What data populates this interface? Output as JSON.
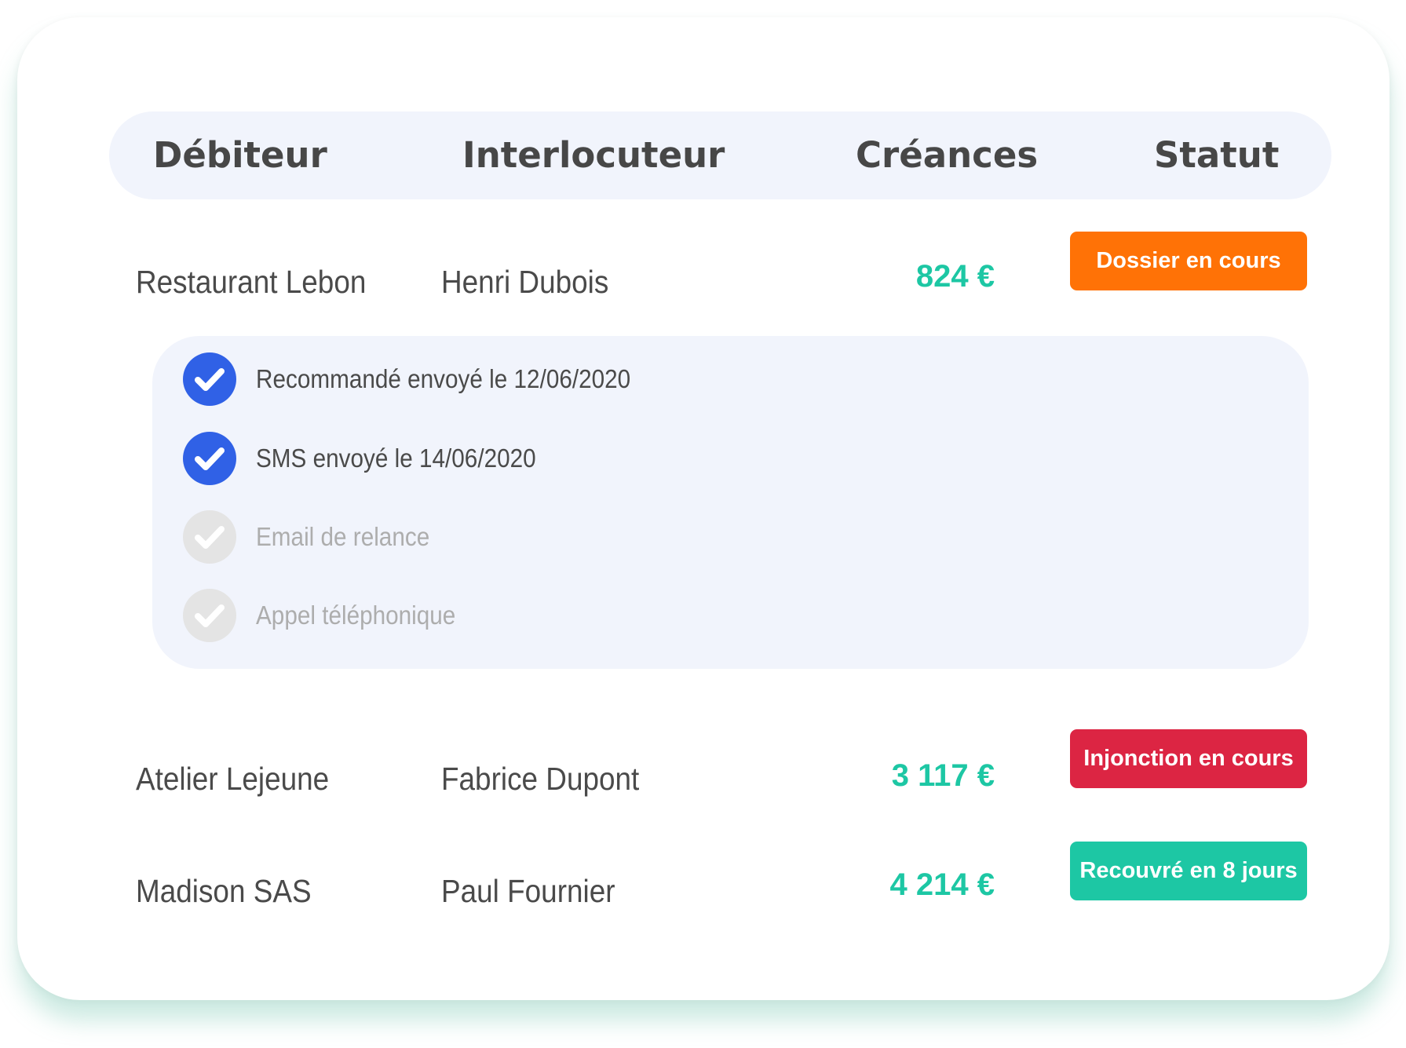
{
  "header": {
    "debiteur": "Débiteur",
    "interlocuteur": "Interlocuteur",
    "creances": "Créances",
    "statut": "Statut"
  },
  "rows": [
    {
      "debiteur": "Restaurant Lebon",
      "interlocuteur": "Henri Dubois",
      "creance": "824 €",
      "statut": "Dossier en cours",
      "statut_color": "#ff7206"
    },
    {
      "debiteur": "Atelier Lejeune",
      "interlocuteur": "Fabrice Dupont",
      "creance": "3 117 €",
      "statut": "Injonction en cours",
      "statut_color": "#dc2543"
    },
    {
      "debiteur": "Madison SAS",
      "interlocuteur": "Paul Fournier",
      "creance": "4 214 €",
      "statut": "Recouvré en 8 jours",
      "statut_color": "#1dc7a4"
    }
  ],
  "steps": [
    {
      "label": "Recommandé envoyé le 12/06/2020",
      "done": true,
      "icon": "check-icon"
    },
    {
      "label": "SMS envoyé le 14/06/2020",
      "done": true,
      "icon": "check-icon"
    },
    {
      "label": "Email de relance",
      "done": false,
      "icon": "check-icon"
    },
    {
      "label": "Appel téléphonique",
      "done": false,
      "icon": "check-icon"
    }
  ],
  "colors": {
    "accent_green": "#1dc7a4",
    "check_done": "#3061e6",
    "check_todo": "#e4e4e4",
    "panel_bg": "#f1f4fc"
  }
}
